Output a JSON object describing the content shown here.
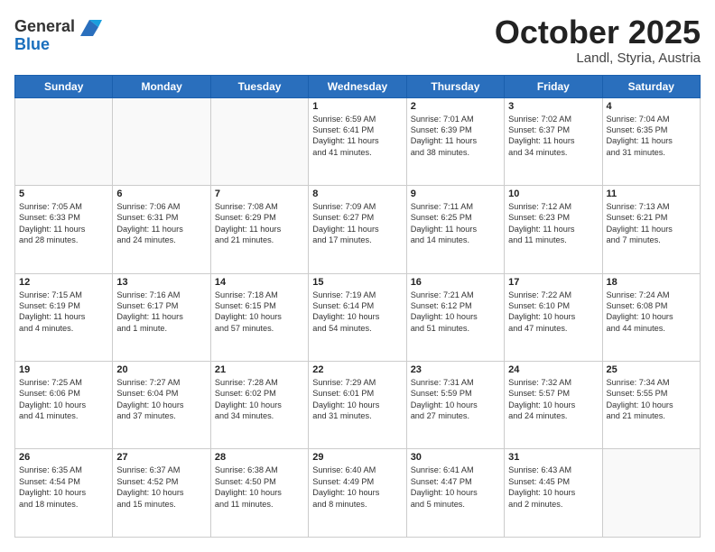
{
  "header": {
    "logo_line1": "General",
    "logo_line2": "Blue",
    "month": "October 2025",
    "location": "Landl, Styria, Austria"
  },
  "days_of_week": [
    "Sunday",
    "Monday",
    "Tuesday",
    "Wednesday",
    "Thursday",
    "Friday",
    "Saturday"
  ],
  "weeks": [
    [
      {
        "day": "",
        "info": ""
      },
      {
        "day": "",
        "info": ""
      },
      {
        "day": "",
        "info": ""
      },
      {
        "day": "1",
        "info": "Sunrise: 6:59 AM\nSunset: 6:41 PM\nDaylight: 11 hours\nand 41 minutes."
      },
      {
        "day": "2",
        "info": "Sunrise: 7:01 AM\nSunset: 6:39 PM\nDaylight: 11 hours\nand 38 minutes."
      },
      {
        "day": "3",
        "info": "Sunrise: 7:02 AM\nSunset: 6:37 PM\nDaylight: 11 hours\nand 34 minutes."
      },
      {
        "day": "4",
        "info": "Sunrise: 7:04 AM\nSunset: 6:35 PM\nDaylight: 11 hours\nand 31 minutes."
      }
    ],
    [
      {
        "day": "5",
        "info": "Sunrise: 7:05 AM\nSunset: 6:33 PM\nDaylight: 11 hours\nand 28 minutes."
      },
      {
        "day": "6",
        "info": "Sunrise: 7:06 AM\nSunset: 6:31 PM\nDaylight: 11 hours\nand 24 minutes."
      },
      {
        "day": "7",
        "info": "Sunrise: 7:08 AM\nSunset: 6:29 PM\nDaylight: 11 hours\nand 21 minutes."
      },
      {
        "day": "8",
        "info": "Sunrise: 7:09 AM\nSunset: 6:27 PM\nDaylight: 11 hours\nand 17 minutes."
      },
      {
        "day": "9",
        "info": "Sunrise: 7:11 AM\nSunset: 6:25 PM\nDaylight: 11 hours\nand 14 minutes."
      },
      {
        "day": "10",
        "info": "Sunrise: 7:12 AM\nSunset: 6:23 PM\nDaylight: 11 hours\nand 11 minutes."
      },
      {
        "day": "11",
        "info": "Sunrise: 7:13 AM\nSunset: 6:21 PM\nDaylight: 11 hours\nand 7 minutes."
      }
    ],
    [
      {
        "day": "12",
        "info": "Sunrise: 7:15 AM\nSunset: 6:19 PM\nDaylight: 11 hours\nand 4 minutes."
      },
      {
        "day": "13",
        "info": "Sunrise: 7:16 AM\nSunset: 6:17 PM\nDaylight: 11 hours\nand 1 minute."
      },
      {
        "day": "14",
        "info": "Sunrise: 7:18 AM\nSunset: 6:15 PM\nDaylight: 10 hours\nand 57 minutes."
      },
      {
        "day": "15",
        "info": "Sunrise: 7:19 AM\nSunset: 6:14 PM\nDaylight: 10 hours\nand 54 minutes."
      },
      {
        "day": "16",
        "info": "Sunrise: 7:21 AM\nSunset: 6:12 PM\nDaylight: 10 hours\nand 51 minutes."
      },
      {
        "day": "17",
        "info": "Sunrise: 7:22 AM\nSunset: 6:10 PM\nDaylight: 10 hours\nand 47 minutes."
      },
      {
        "day": "18",
        "info": "Sunrise: 7:24 AM\nSunset: 6:08 PM\nDaylight: 10 hours\nand 44 minutes."
      }
    ],
    [
      {
        "day": "19",
        "info": "Sunrise: 7:25 AM\nSunset: 6:06 PM\nDaylight: 10 hours\nand 41 minutes."
      },
      {
        "day": "20",
        "info": "Sunrise: 7:27 AM\nSunset: 6:04 PM\nDaylight: 10 hours\nand 37 minutes."
      },
      {
        "day": "21",
        "info": "Sunrise: 7:28 AM\nSunset: 6:02 PM\nDaylight: 10 hours\nand 34 minutes."
      },
      {
        "day": "22",
        "info": "Sunrise: 7:29 AM\nSunset: 6:01 PM\nDaylight: 10 hours\nand 31 minutes."
      },
      {
        "day": "23",
        "info": "Sunrise: 7:31 AM\nSunset: 5:59 PM\nDaylight: 10 hours\nand 27 minutes."
      },
      {
        "day": "24",
        "info": "Sunrise: 7:32 AM\nSunset: 5:57 PM\nDaylight: 10 hours\nand 24 minutes."
      },
      {
        "day": "25",
        "info": "Sunrise: 7:34 AM\nSunset: 5:55 PM\nDaylight: 10 hours\nand 21 minutes."
      }
    ],
    [
      {
        "day": "26",
        "info": "Sunrise: 6:35 AM\nSunset: 4:54 PM\nDaylight: 10 hours\nand 18 minutes."
      },
      {
        "day": "27",
        "info": "Sunrise: 6:37 AM\nSunset: 4:52 PM\nDaylight: 10 hours\nand 15 minutes."
      },
      {
        "day": "28",
        "info": "Sunrise: 6:38 AM\nSunset: 4:50 PM\nDaylight: 10 hours\nand 11 minutes."
      },
      {
        "day": "29",
        "info": "Sunrise: 6:40 AM\nSunset: 4:49 PM\nDaylight: 10 hours\nand 8 minutes."
      },
      {
        "day": "30",
        "info": "Sunrise: 6:41 AM\nSunset: 4:47 PM\nDaylight: 10 hours\nand 5 minutes."
      },
      {
        "day": "31",
        "info": "Sunrise: 6:43 AM\nSunset: 4:45 PM\nDaylight: 10 hours\nand 2 minutes."
      },
      {
        "day": "",
        "info": ""
      }
    ]
  ]
}
